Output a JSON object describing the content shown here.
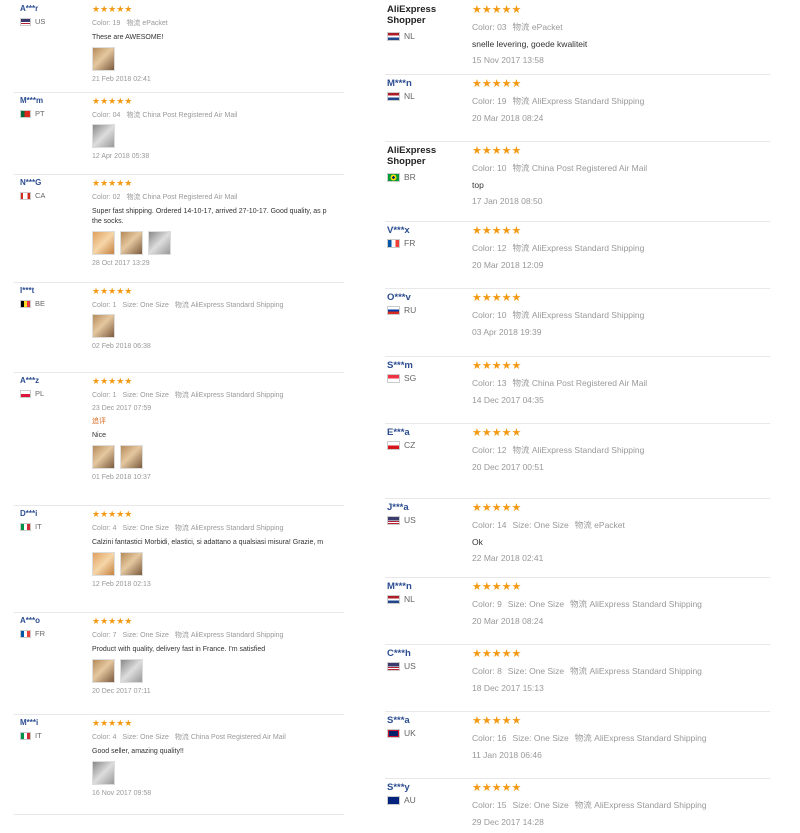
{
  "labels": {
    "color": "Color:",
    "size": "Size:",
    "shipping_prefix": "物流"
  },
  "left": [
    {
      "name": "A***r",
      "country": "US",
      "flag": "us",
      "stars": "★★★★★",
      "color": "19",
      "size": "",
      "shipping": "ePacket",
      "text": "These are AWESOME!",
      "thumbs": 1,
      "date": "21 Feb 2018 02:41"
    },
    {
      "name": "M***m",
      "country": "PT",
      "flag": "pt",
      "stars": "★★★★★",
      "color": "04",
      "size": "",
      "shipping": "China Post Registered Air Mail",
      "text": "",
      "thumbs": 1,
      "date": "12 Apr 2018 05:38"
    },
    {
      "name": "N***G",
      "country": "CA",
      "flag": "ca",
      "stars": "★★★★★",
      "color": "02",
      "size": "",
      "shipping": "China Post Registered Air Mail",
      "text": "Super fast shipping. Ordered 14-10-17, arrived 27-10-17. Good quality, as p",
      "text2": "the socks.",
      "thumbs": 3,
      "date": "28 Oct 2017 13:29"
    },
    {
      "name": "I***t",
      "country": "BE",
      "flag": "be",
      "stars": "★★★★★",
      "color": "1",
      "size": "One Size",
      "shipping": "AliExpress Standard Shipping",
      "text": "",
      "thumbs": 1,
      "date": "02 Feb 2018 06:38"
    },
    {
      "name": "A***z",
      "country": "PL",
      "flag": "pl",
      "stars": "★★★★★",
      "color": "1",
      "size": "One Size",
      "shipping": "AliExpress Standard Shipping",
      "text": "",
      "thumbs": 0,
      "date": "23 Dec 2017 07:59",
      "additional": "追评",
      "text_after": "Nice",
      "thumbs_after": 2,
      "date_after": "01 Feb 2018 10:37"
    },
    {
      "name": "D***i",
      "country": "IT",
      "flag": "it",
      "stars": "★★★★★",
      "color": "4",
      "size": "One Size",
      "shipping": "AliExpress Standard Shipping",
      "text": "Calzini fantastici Morbidi, elastici, si adattano a qualsiasi misura! Grazie, m",
      "thumbs": 2,
      "date": "12 Feb 2018 02:13"
    },
    {
      "name": "A***o",
      "country": "FR",
      "flag": "fr",
      "stars": "★★★★★",
      "color": "7",
      "size": "One Size",
      "shipping": "AliExpress Standard Shipping",
      "text": "Product with quality, delivery fast in France. I'm satisfied",
      "thumbs": 2,
      "date": "20 Dec 2017 07:11"
    },
    {
      "name": "M***i",
      "country": "IT",
      "flag": "it",
      "stars": "★★★★★",
      "color": "4",
      "size": "One Size",
      "shipping": "China Post Registered Air Mail",
      "text": "Good seller, amazing quality!!",
      "thumbs": 1,
      "date": "16 Nov 2017 09:58"
    }
  ],
  "right": [
    {
      "name": "AliExpress",
      "name2": "Shopper",
      "country": "NL",
      "flag": "nl",
      "stars": "★★★★★",
      "color": "03",
      "size": "",
      "shipping": "ePacket",
      "text": "snelle levering, goede kwaliteit",
      "date": "15 Nov 2017 13:58"
    },
    {
      "name": "M***n",
      "country": "NL",
      "flag": "nl",
      "stars": "★★★★★",
      "color": "19",
      "size": "",
      "shipping": "AliExpress Standard Shipping",
      "text": "",
      "date": "20 Mar 2018 08:24"
    },
    {
      "name": "AliExpress",
      "name2": "Shopper",
      "country": "BR",
      "flag": "br",
      "stars": "★★★★★",
      "color": "10",
      "size": "",
      "shipping": "China Post Registered Air Mail",
      "text": "top",
      "date": "17 Jan 2018 08:50"
    },
    {
      "name": "V***x",
      "country": "FR",
      "flag": "fr",
      "stars": "★★★★★",
      "color": "12",
      "size": "",
      "shipping": "AliExpress Standard Shipping",
      "text": "",
      "date": "20 Mar 2018 12:09"
    },
    {
      "name": "O***v",
      "country": "RU",
      "flag": "ru",
      "stars": "★★★★★",
      "color": "10",
      "size": "",
      "shipping": "AliExpress Standard Shipping",
      "text": "",
      "date": "03 Apr 2018 19:39"
    },
    {
      "name": "S***m",
      "country": "SG",
      "flag": "sg",
      "stars": "★★★★★",
      "color": "13",
      "size": "",
      "shipping": "China Post Registered Air Mail",
      "text": "",
      "date": "14 Dec 2017 04:35"
    },
    {
      "name": "E***a",
      "country": "CZ",
      "flag": "cz",
      "stars": "★★★★★",
      "color": "12",
      "size": "",
      "shipping": "AliExpress Standard Shipping",
      "text": "",
      "date": "20 Dec 2017 00:51"
    },
    {
      "name": "J***a",
      "country": "US",
      "flag": "us",
      "stars": "★★★★★",
      "color": "14",
      "size": "One Size",
      "shipping": "ePacket",
      "text": "Ok",
      "date": "22 Mar 2018 02:41"
    },
    {
      "name": "M***n",
      "country": "NL",
      "flag": "nl",
      "stars": "★★★★★",
      "color": "9",
      "size": "One Size",
      "shipping": "AliExpress Standard Shipping",
      "text": "",
      "date": "20 Mar 2018 08:24"
    },
    {
      "name": "C***h",
      "country": "US",
      "flag": "us",
      "stars": "★★★★★",
      "color": "8",
      "size": "One Size",
      "shipping": "AliExpress Standard Shipping",
      "text": "",
      "date": "18 Dec 2017 15:13"
    },
    {
      "name": "S***a",
      "country": "UK",
      "flag": "gb",
      "stars": "★★★★★",
      "color": "16",
      "size": "One Size",
      "shipping": "AliExpress Standard Shipping",
      "text": "",
      "date": "11 Jan 2018 06:46"
    },
    {
      "name": "S***y",
      "country": "AU",
      "flag": "au",
      "stars": "★★★★★",
      "color": "15",
      "size": "One Size",
      "shipping": "AliExpress Standard Shipping",
      "text": "",
      "date": "29 Dec 2017 14:28"
    }
  ]
}
